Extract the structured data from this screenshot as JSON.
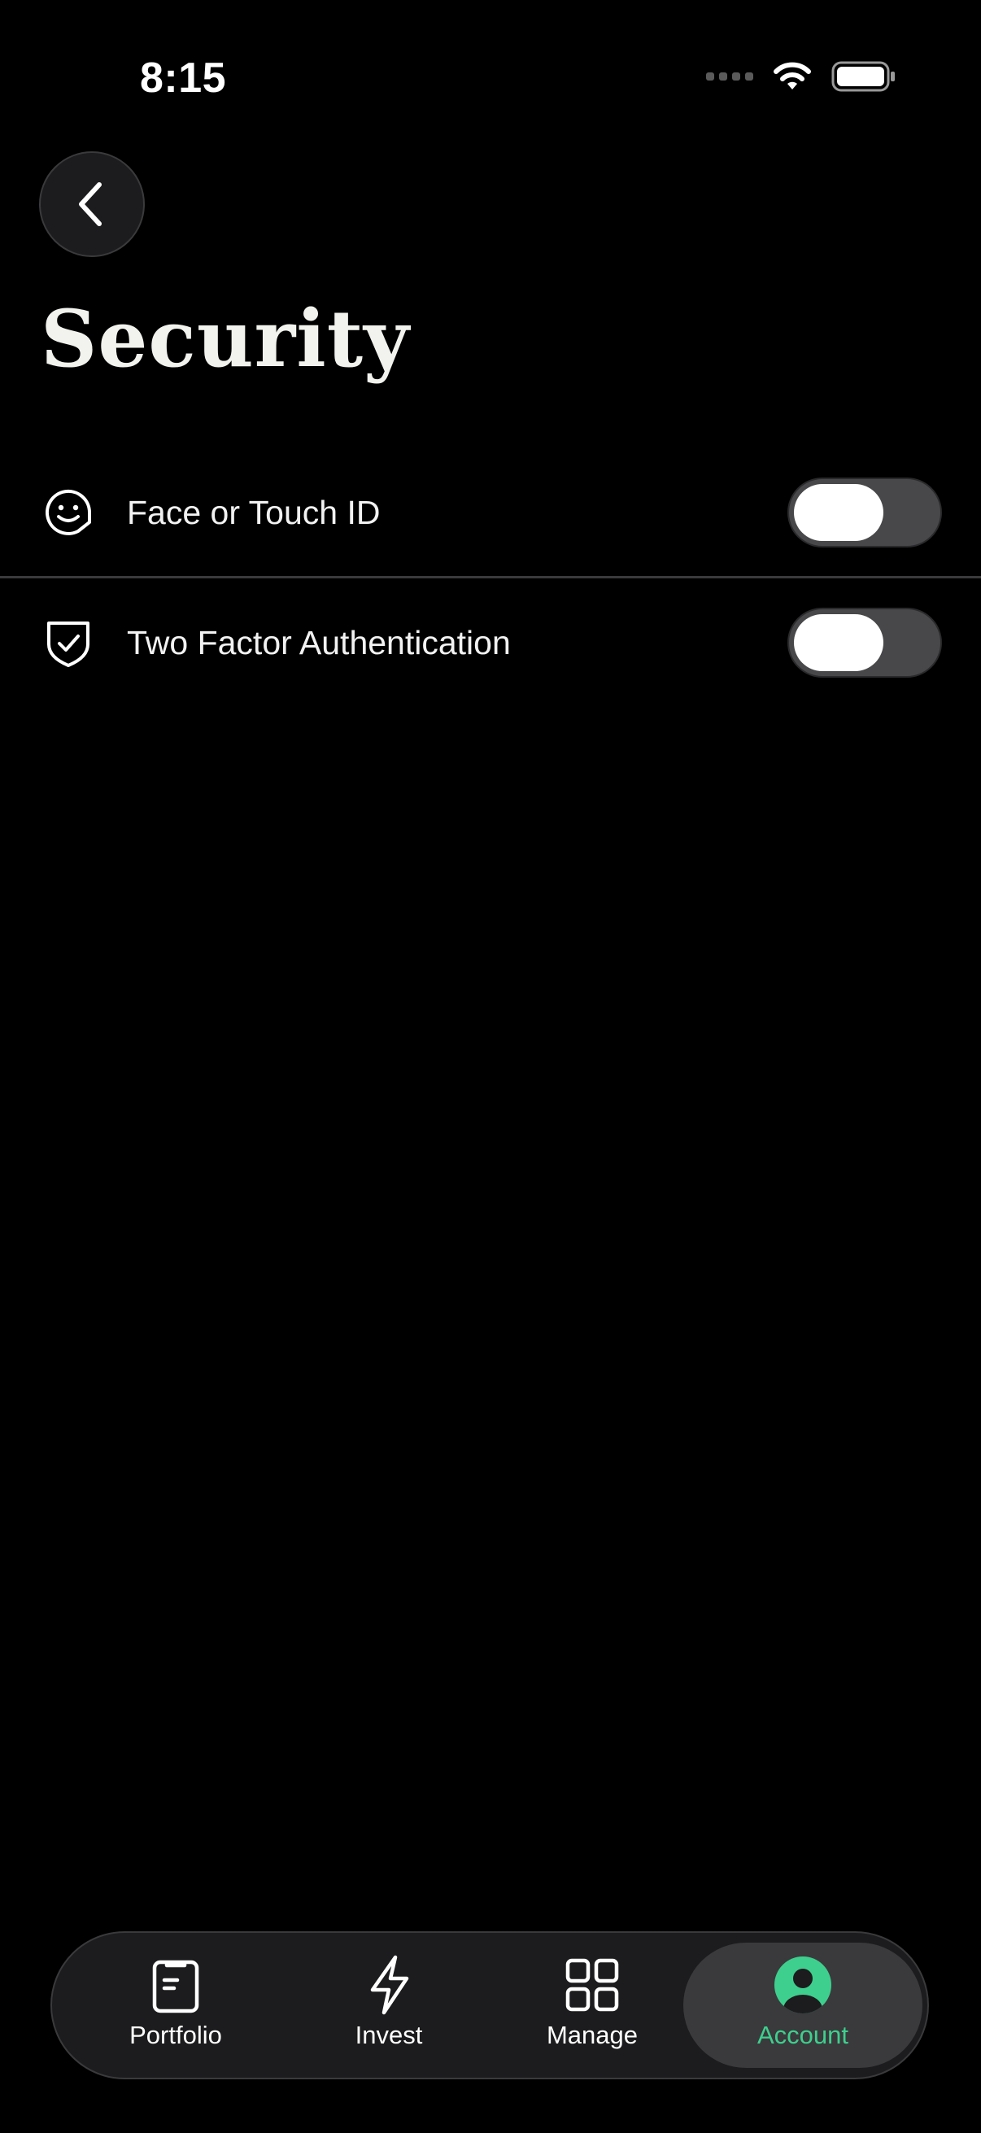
{
  "status_bar": {
    "time": "8:15"
  },
  "header": {
    "title": "Security"
  },
  "settings": [
    {
      "label": "Face or Touch ID",
      "icon": "face-id-icon",
      "enabled": false
    },
    {
      "label": "Two Factor Authentication",
      "icon": "shield-check-icon",
      "enabled": false
    }
  ],
  "tabs": [
    {
      "label": "Portfolio",
      "icon": "clipboard-icon",
      "active": false
    },
    {
      "label": "Invest",
      "icon": "lightning-icon",
      "active": false
    },
    {
      "label": "Manage",
      "icon": "grid-icon",
      "active": false
    },
    {
      "label": "Account",
      "icon": "account-icon",
      "active": true
    }
  ],
  "colors": {
    "background": "#000000",
    "accent": "#3ecf8e",
    "toggle_track": "#48484a"
  }
}
